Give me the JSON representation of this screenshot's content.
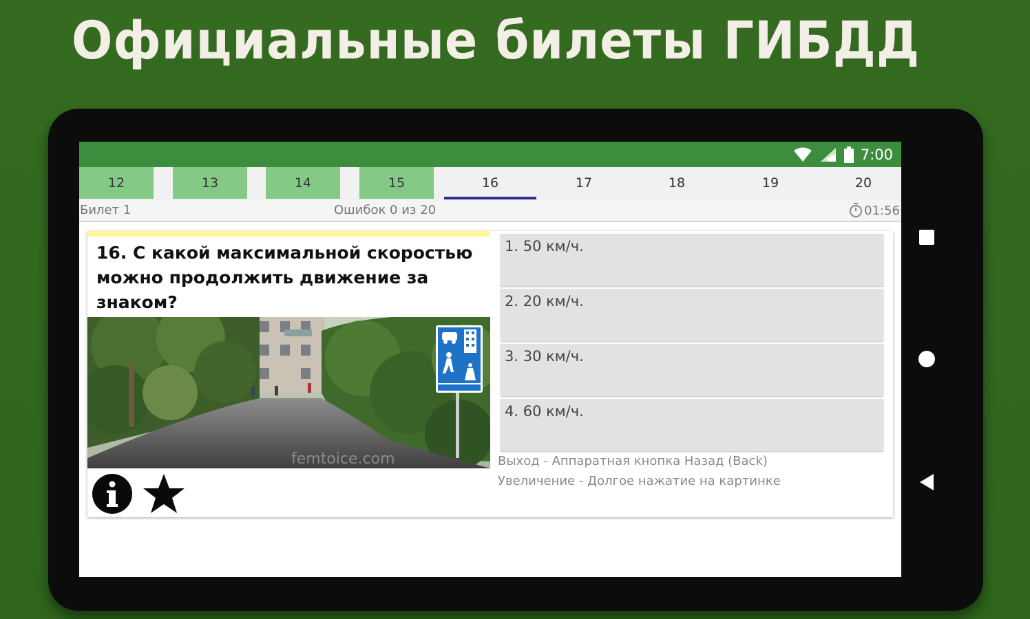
{
  "headline": "Официальные билеты ГИБДД",
  "status_bar": {
    "time": "7:00",
    "icons": [
      "wifi-icon",
      "cell-signal-icon",
      "battery-icon"
    ]
  },
  "tabs": [
    {
      "label": "12",
      "answered": true
    },
    {
      "label": "13",
      "answered": true
    },
    {
      "label": "14",
      "answered": true
    },
    {
      "label": "15",
      "answered": true
    },
    {
      "label": "16",
      "active": true
    },
    {
      "label": "17"
    },
    {
      "label": "18"
    },
    {
      "label": "19"
    },
    {
      "label": "20"
    }
  ],
  "info": {
    "ticket": "Билет 1",
    "errors": "Ошибок 0 из 20",
    "timer": "01:56"
  },
  "question": {
    "text": "16. С какой максимальной скоростью можно продолжить движение за знаком?",
    "watermark": "femtoice.com"
  },
  "answers": [
    "1. 50 км/ч.",
    "2. 20 км/ч.",
    "3. 30 км/ч.",
    "4. 60 км/ч."
  ],
  "hints": {
    "exit": "Выход - Аппаратная кнопка Назад (Back)",
    "zoom": "Увеличение - Долгое нажатие на картинке"
  },
  "colors": {
    "background": "#33691e",
    "status_bar": "#3c8e3e",
    "answered_tab": "#85c987",
    "active_indicator": "#2b2f8f",
    "highlight_strip": "#fff59d"
  }
}
